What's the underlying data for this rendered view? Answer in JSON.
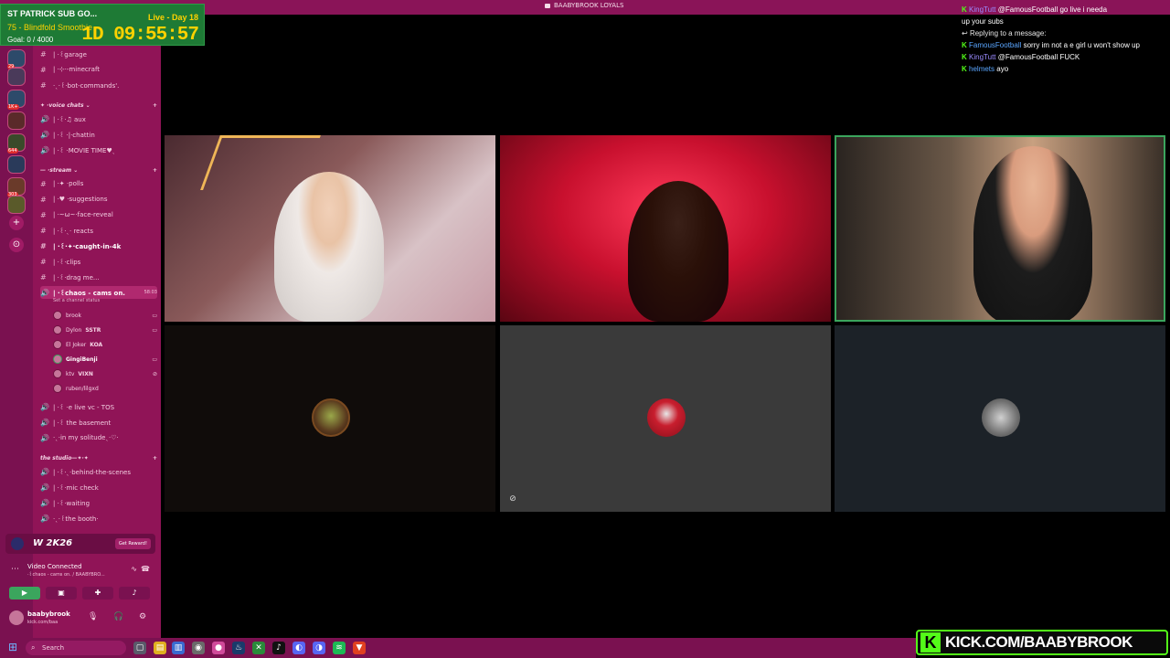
{
  "window_title": "BAABYBROOK LOYALS",
  "goal": {
    "title": "ST PATRICK SUB GO...",
    "subtitle": "75 - Blindfold Smoothie",
    "count": "Goal: 0 / 4000",
    "day": "Live - Day 18",
    "timer": "1D 09:55:57"
  },
  "rail": {
    "badges": [
      "29",
      "1K+",
      "644",
      "303"
    ]
  },
  "sidebar": {
    "channels_top": [
      {
        "sym": "#",
        "label": "| ·꒰garage"
      },
      {
        "sym": "#",
        "label": "| ·⊹·-minecraft"
      },
      {
        "sym": "#",
        "label": "·ˎ·꒰·bot-commands'."
      }
    ],
    "cat_voice": "✦ ·voice chats ⌄",
    "voice_channels": [
      {
        "sym": "🔊",
        "label": "| ·꒰·♫ aux"
      },
      {
        "sym": "🔊",
        "label": "| ·꒰ ·|·chattin"
      },
      {
        "sym": "🔊",
        "label": "| ·꒰ ·MOVIE TIME♥ˎ"
      }
    ],
    "cat_stream": "— ·stream ⌄",
    "stream_channels": [
      {
        "sym": "#",
        "label": "| ·✦ ·polls"
      },
      {
        "sym": "#",
        "label": "| ·♥ ·suggestions"
      },
      {
        "sym": "#",
        "label": "| ·~ω~·face-reveal"
      },
      {
        "sym": "#",
        "label": "| ·꒰·ˎ· reacts"
      },
      {
        "sym": "#",
        "label": "| ·꒰·✦·caught-in-4k"
      },
      {
        "sym": "#",
        "label": "| ·꒰·clips"
      },
      {
        "sym": "#",
        "label": "| ·꒰·drag me..."
      }
    ],
    "active_channel": "| ·꒰chaos - cams on.",
    "active_meta": "58:03",
    "active_status": "Set a channel status",
    "members": [
      {
        "name": "brook",
        "tag": ""
      },
      {
        "name": "Dylon",
        "tag": "SSTR"
      },
      {
        "name": "El Joker",
        "tag": "KOA"
      },
      {
        "name": "GingiBenji",
        "tag": ""
      },
      {
        "name": "ktv",
        "tag": "VIXN"
      },
      {
        "name": "ruben/lilgxd",
        "tag": ""
      }
    ],
    "voice_channels_2": [
      {
        "sym": "🔊",
        "label": "| ·꒰ ·e live vc - TOS"
      },
      {
        "sym": "🔊",
        "label": "| ·꒰ the basement"
      },
      {
        "sym": "🔊",
        "label": "·ˎ·in my solitudeˎ·♡·"
      }
    ],
    "cat_studio": "the studio—✦·✦",
    "studio_channels": [
      {
        "sym": "🔊",
        "label": "| ·꒰·ˎ·behind-the-scenes"
      },
      {
        "sym": "🔊",
        "label": "| ·꒰·mic check"
      },
      {
        "sym": "🔊",
        "label": "| ·꒰·waiting"
      },
      {
        "sym": "🔊",
        "label": "·ˎ·꒰the booth·"
      }
    ],
    "promo": {
      "game": "W 2K26",
      "button": "Get Reward!"
    },
    "voice_status": {
      "title": "Video Connected",
      "sub": "·꒰chaos - cams on. / BAABYBRO..."
    },
    "user": {
      "name": "baabybrook",
      "status": "kick.com/baa"
    }
  },
  "chat": {
    "messages": [
      {
        "badge": "K",
        "user": "KingTutt",
        "text": "@FamousFootball go live i needa"
      },
      {
        "badge": "",
        "user": "",
        "text": "up your subs"
      },
      {
        "badge": "↩",
        "user": "",
        "text": "Replying to a message:"
      },
      {
        "badge": "K",
        "user": "FamousFootball",
        "text": "sorry im not a e girl u won't show up"
      },
      {
        "badge": "K",
        "user": "KingTutt",
        "text": "@FamousFootball FUCK"
      },
      {
        "badge": "K",
        "user": "helmets",
        "text": "ayo"
      }
    ]
  },
  "brand": {
    "k": "K",
    "text": "KICK.COM/BAABYBROOK"
  },
  "taskbar": {
    "search_placeholder": "Search"
  },
  "colors": {
    "kick_green": "#53fc18",
    "discord_pink": "#901457",
    "speaking": "#3ba55d",
    "goal_green": "#1e7a35",
    "timer_yellow": "#ffd200"
  }
}
